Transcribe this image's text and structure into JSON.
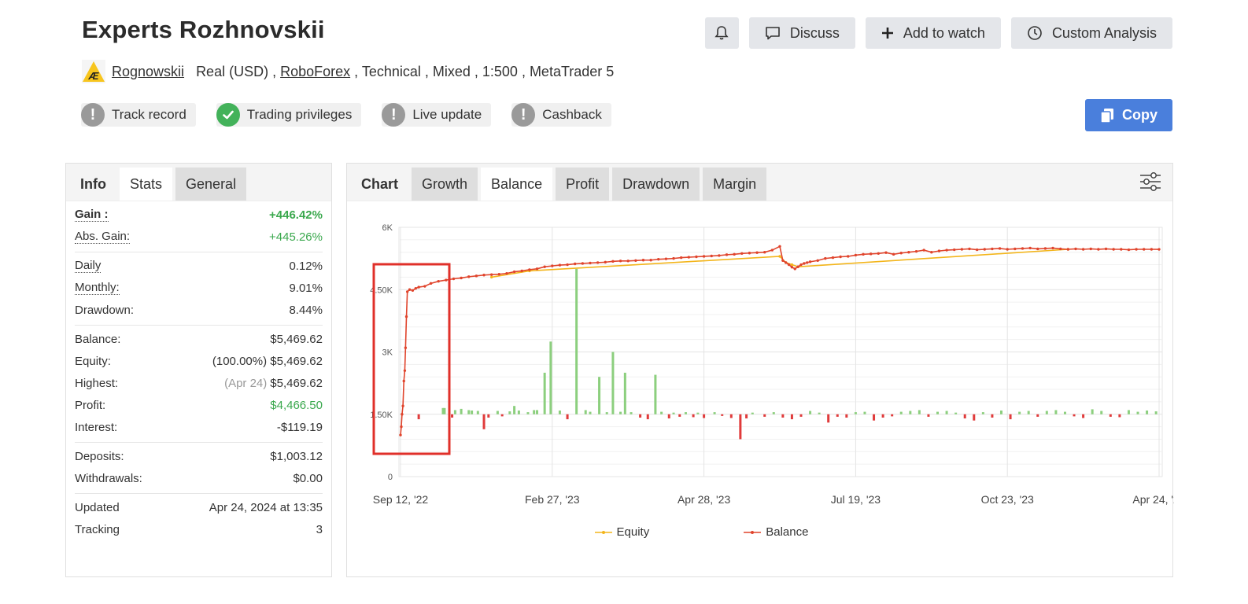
{
  "header": {
    "title": "Experts Rozhnovskii",
    "actions": {
      "discuss": "Discuss",
      "add_watch": "Add to watch",
      "custom_analysis": "Custom Analysis"
    }
  },
  "meta": {
    "user": "Rognowskii",
    "account": "Real (USD) ,",
    "broker": "RoboForex",
    "details": ", Technical , Mixed , 1:500 , MetaTrader 5"
  },
  "badges": [
    "Track record",
    "Trading privileges",
    "Live update",
    "Cashback"
  ],
  "copy_label": "Copy",
  "left_tabs": [
    "Info",
    "Stats",
    "General"
  ],
  "stats": {
    "gain_label": "Gain :",
    "gain": "+446.42%",
    "abs_gain_label": "Abs. Gain:",
    "abs_gain": "+445.26%",
    "daily_label": "Daily",
    "daily": "0.12%",
    "monthly_label": "Monthly:",
    "monthly": "9.01%",
    "drawdown_label": "Drawdown:",
    "drawdown": "8.44%",
    "balance_label": "Balance:",
    "balance": "$5,469.62",
    "equity_label": "Equity:",
    "equity_pct": "(100.00%)",
    "equity": "$5,469.62",
    "highest_label": "Highest:",
    "highest_date": "(Apr 24)",
    "highest": "$5,469.62",
    "profit_label": "Profit:",
    "profit": "$4,466.50",
    "interest_label": "Interest:",
    "interest": "-$119.19",
    "deposits_label": "Deposits:",
    "deposits": "$1,003.12",
    "withdrawals_label": "Withdrawals:",
    "withdrawals": "$0.00",
    "updated_label": "Updated",
    "updated": "Apr 24, 2024 at 13:35",
    "tracking_label": "Tracking",
    "tracking": "3"
  },
  "chart_tabs": [
    "Chart",
    "Growth",
    "Balance",
    "Profit",
    "Drawdown",
    "Margin"
  ],
  "colors": {
    "balance": "#e0442c",
    "equity": "#f3b51b",
    "bar_pos": "#8ccf7e",
    "bar_neg": "#e03b3b",
    "highlight": "#e0302a",
    "copy_btn": "#4a7fdc",
    "gain": "#3aa84d"
  },
  "chart_data": {
    "type": "line",
    "y_ticks": [
      "0",
      "1.50K",
      "3K",
      "4.50K",
      "6K"
    ],
    "ylim": [
      0,
      6000
    ],
    "x_ticks": [
      "Sep 12, '22",
      "Feb 27, '23",
      "Apr 28, '23",
      "Jul 19, '23",
      "Oct 23, '23",
      "Apr 24, '24"
    ],
    "legend": [
      "Equity",
      "Balance"
    ],
    "grid": true,
    "series": [
      {
        "name": "Balance",
        "x": [
          0,
          0.5,
          1,
          1.6,
          2.2,
          2.8,
          3.3,
          3.9,
          4.5,
          6,
          8,
          10,
          12,
          16,
          20,
          25,
          30,
          35,
          40,
          45,
          50,
          55,
          60,
          65,
          70,
          75,
          80,
          85,
          90,
          95,
          100,
          105,
          110,
          115,
          120,
          125,
          130,
          135,
          140,
          145,
          150,
          155,
          160,
          165,
          170,
          175,
          180,
          185,
          190,
          195,
          200,
          205,
          210,
          215,
          220,
          225,
          230,
          235,
          240,
          245,
          250,
          252,
          254,
          256,
          258,
          260,
          262,
          264,
          266,
          268,
          270,
          275,
          280,
          285,
          290,
          295,
          300,
          305,
          310,
          315,
          320,
          325,
          330,
          335,
          340,
          345,
          350,
          355,
          360,
          365,
          370,
          375,
          380,
          385,
          390,
          395,
          400,
          405,
          410,
          415,
          420,
          425,
          430,
          435,
          440,
          445,
          450,
          455,
          460,
          465,
          470,
          475,
          480,
          485,
          490,
          495,
          500
        ],
        "y": [
          1000,
          1200,
          1500,
          1700,
          2300,
          2550,
          3100,
          3850,
          4450,
          4500,
          4480,
          4530,
          4560,
          4580,
          4650,
          4700,
          4730,
          4760,
          4780,
          4810,
          4830,
          4850,
          4860,
          4870,
          4890,
          4930,
          4950,
          4980,
          5000,
          5050,
          5070,
          5090,
          5100,
          5120,
          5130,
          5140,
          5150,
          5160,
          5180,
          5190,
          5190,
          5200,
          5210,
          5210,
          5230,
          5240,
          5250,
          5270,
          5280,
          5290,
          5300,
          5310,
          5320,
          5340,
          5350,
          5370,
          5380,
          5390,
          5400,
          5450,
          5540,
          5200,
          5150,
          5100,
          5040,
          5000,
          5050,
          5100,
          5130,
          5150,
          5170,
          5200,
          5250,
          5270,
          5290,
          5300,
          5330,
          5350,
          5360,
          5370,
          5390,
          5350,
          5380,
          5400,
          5420,
          5450,
          5400,
          5430,
          5450,
          5460,
          5470,
          5480,
          5460,
          5470,
          5480,
          5490,
          5470,
          5480,
          5490,
          5500,
          5480,
          5490,
          5500,
          5480,
          5470,
          5480,
          5470,
          5480,
          5470,
          5480,
          5470,
          5470,
          5460,
          5470,
          5470,
          5470,
          5469.62
        ]
      },
      {
        "name": "Equity",
        "x": [
          60,
          85,
          250,
          254,
          258,
          262,
          440
        ],
        "y": [
          4800,
          4950,
          5300,
          5150,
          5100,
          5050,
          5470
        ]
      }
    ],
    "bars_x": [
      12,
      28,
      29,
      34,
      36,
      40,
      45,
      47,
      51,
      55,
      58,
      64,
      67,
      72,
      75,
      78,
      84,
      88,
      90,
      95,
      99,
      105,
      110,
      116,
      122,
      125,
      131,
      136,
      140,
      145,
      148,
      152,
      158,
      163,
      168,
      172,
      177,
      180,
      184,
      188,
      193,
      196,
      200,
      207,
      212,
      218,
      224,
      228,
      232,
      240,
      246,
      252,
      258,
      264,
      270,
      276,
      282,
      288,
      294,
      300,
      306,
      312,
      318,
      324,
      330,
      336,
      342,
      348,
      354,
      360,
      366,
      372,
      378,
      384,
      390,
      396,
      402,
      408,
      414,
      420,
      426,
      432,
      438,
      444,
      450,
      456,
      462,
      468,
      474,
      480,
      486,
      492,
      498
    ],
    "bars_y": [
      -120,
      150,
      150,
      -80,
      100,
      130,
      100,
      90,
      80,
      -360,
      -80,
      80,
      -50,
      70,
      200,
      90,
      50,
      100,
      100,
      1000,
      1750,
      90,
      -120,
      3500,
      100,
      60,
      900,
      50,
      1500,
      60,
      1000,
      50,
      -80,
      -120,
      950,
      60,
      -100,
      40,
      -60,
      50,
      -70,
      40,
      -90,
      50,
      -40,
      -90,
      -600,
      -100,
      40,
      -60,
      50,
      -80,
      -120,
      -60,
      80,
      40,
      -200,
      -60,
      -80,
      50,
      60,
      -150,
      -80,
      -50,
      60,
      80,
      100,
      -60,
      60,
      80,
      40,
      -100,
      -150,
      50,
      -80,
      90,
      -120,
      60,
      80,
      -60,
      80,
      100,
      60,
      -50,
      -90,
      120,
      80,
      -60,
      -70,
      100,
      60,
      90,
      70
    ]
  }
}
